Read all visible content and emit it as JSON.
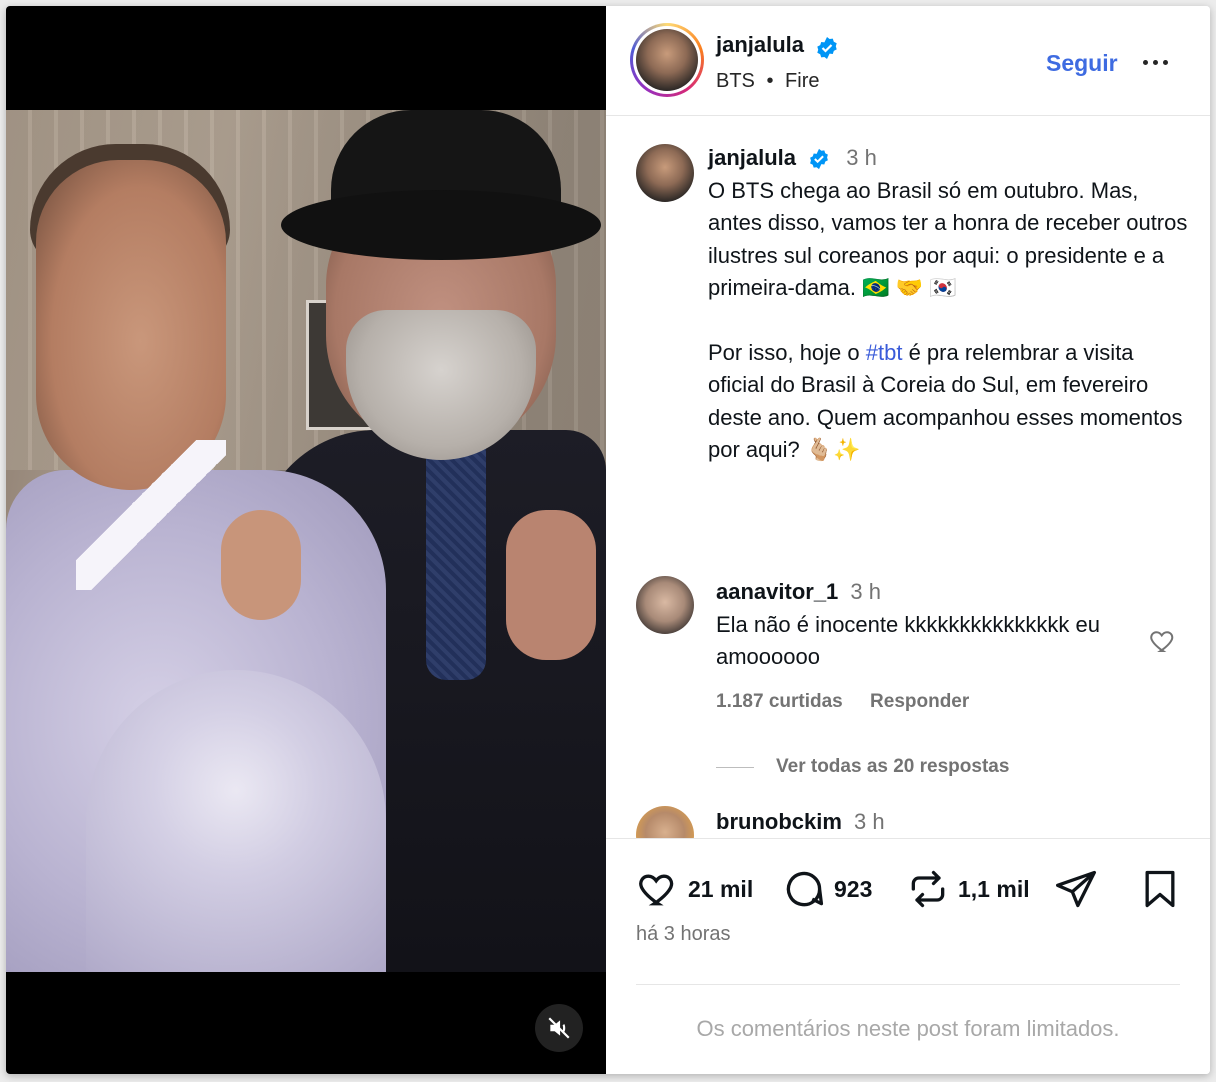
{
  "post": {
    "author": "janjalula",
    "music": {
      "artist": "BTS",
      "separator": "•",
      "track": "Fire"
    },
    "follow_label": "Seguir",
    "caption": {
      "username": "janjalula",
      "time": "3 h",
      "paragraph1": "O BTS chega ao Brasil só em outubro. Mas, antes disso, vamos ter a honra de receber outros ilustres sul coreanos por aqui: o presidente e a primeira-dama. 🇧🇷 🤝 🇰🇷",
      "paragraph2_before": "Por isso, hoje o ",
      "hashtag": "#tbt",
      "paragraph2_after": " é pra relembrar a visita oficial do Brasil à Coreia do Sul, em fevereiro deste ano. Quem acompanhou esses momentos por aqui? 🫰🏼✨"
    },
    "comments": [
      {
        "username": "aanavitor_1",
        "time": "3 h",
        "text": "Ela não é inocente kkkkkkkkkkkkkkk eu amoooooo",
        "likes": "1.187 curtidas",
        "reply_label": "Responder"
      },
      {
        "username": "brunobckim",
        "time": "3 h"
      }
    ],
    "view_replies": "Ver todas as 20 respostas",
    "stats": {
      "likes": "21 mil",
      "comments": "923",
      "reposts": "1,1 mil"
    },
    "posted_ago": "há 3 horas",
    "comments_limited": "Os comentários neste post foram limitados."
  },
  "icons": {
    "verified": "verified-badge-icon",
    "more": "more-options-icon",
    "like": "heart-icon",
    "comment": "comment-bubble-icon",
    "repost": "repost-icon",
    "share": "send-icon",
    "save": "bookmark-icon",
    "mute": "muted-speaker-icon"
  },
  "colors": {
    "accent": "#3e6be1",
    "verified": "#0095f6",
    "muted_text": "#737373"
  }
}
